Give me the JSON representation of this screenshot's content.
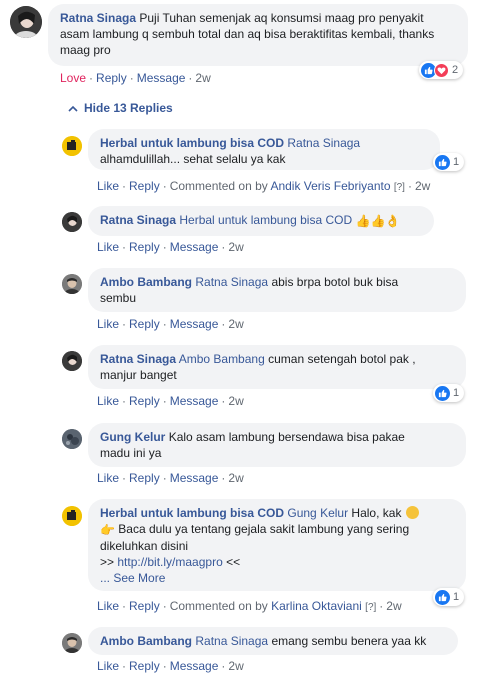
{
  "top_comment": {
    "author": "Ratna Sinaga",
    "text": "Puji Tuhan semenjak aq konsumsi maag pro penyakit asam lambung q sembuh total dan aq bisa beraktifitas kembali, thanks maag pro",
    "actions": {
      "love": "Love",
      "reply": "Reply",
      "message": "Message",
      "time": "2w"
    },
    "reaction_count": "2"
  },
  "hide_replies": "Hide 13 Replies",
  "replies": [
    {
      "author": "Herbal untuk lambung bisa COD",
      "mention": "Ratna Sinaga",
      "text": "alhamdulillah... sehat selalu ya kak",
      "actions": {
        "like": "Like",
        "reply": "Reply",
        "commented_on_by": "Commented on by",
        "commented_by_name": "Andik Veris Febriyanto",
        "info": "[?]",
        "time": "2w"
      },
      "reaction_count": "1"
    },
    {
      "author": "Ratna Sinaga",
      "mention": "Herbal untuk lambung bisa COD",
      "text": "",
      "actions": {
        "like": "Like",
        "reply": "Reply",
        "message": "Message",
        "time": "2w"
      }
    },
    {
      "author": "Ambo Bambang",
      "mention": "Ratna Sinaga",
      "text_line1": "abis brpa botol buk bisa",
      "text_line2": "sembu",
      "actions": {
        "like": "Like",
        "reply": "Reply",
        "message": "Message",
        "time": "2w"
      }
    },
    {
      "author": "Ratna Sinaga",
      "mention": "Ambo Bambang",
      "text_line1": "cuman setengah botol pak ,",
      "text_line2": "manjur banget",
      "actions": {
        "like": "Like",
        "reply": "Reply",
        "message": "Message",
        "time": "2w"
      },
      "reaction_count": "1"
    },
    {
      "author": "Gung Kelur",
      "text_line1": "Kalo asam lambung bersendawa bisa pakae",
      "text_line2": "madu ini ya",
      "actions": {
        "like": "Like",
        "reply": "Reply",
        "message": "Message",
        "time": "2w"
      }
    },
    {
      "author": "Herbal untuk lambung bisa COD",
      "mention": "Gung Kelur",
      "text_line1": "Halo, kak",
      "text_line2": "Baca dulu ya tentang gejala sakit lambung yang sering",
      "text_line3": "dikeluhkan disini",
      "text_line4_prefix": ">> ",
      "link": "http://bit.ly/maagpro",
      "text_line4_suffix": " <<",
      "see_more": "... See More",
      "actions": {
        "like": "Like",
        "reply": "Reply",
        "commented_on_by": "Commented on by",
        "commented_by_name": "Karlina Oktaviani",
        "info": "[?]",
        "time": "2w"
      },
      "reaction_count": "1"
    },
    {
      "author": "Ambo Bambang",
      "mention": "Ratna Sinaga",
      "text": "emang sembu benera yaa kk",
      "actions": {
        "like": "Like",
        "reply": "Reply",
        "message": "Message",
        "time": "2w"
      }
    }
  ],
  "colors": {
    "link": "#385898",
    "bubble": "#f2f3f5",
    "love": "#e0245e",
    "like_blue": "#1877f2",
    "heart_red": "#f33e58"
  }
}
